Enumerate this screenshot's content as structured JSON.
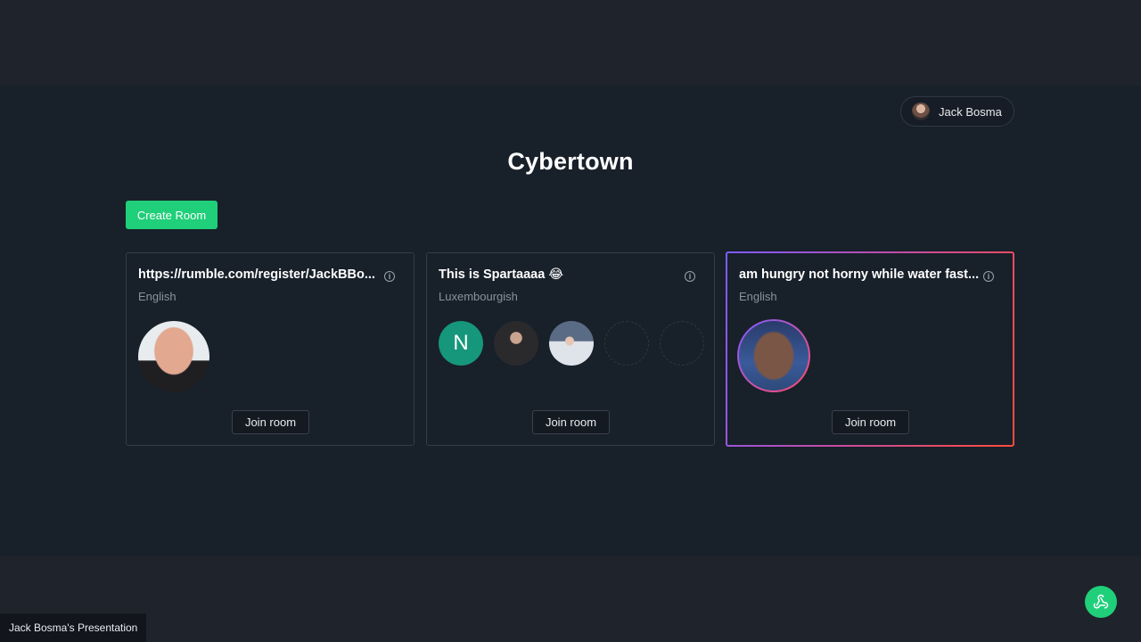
{
  "header": {
    "user_name": "Jack Bosma",
    "app_title": "Cybertown"
  },
  "actions": {
    "create_room_label": "Create Room"
  },
  "rooms": [
    {
      "title": "https://rumble.com/register/JackBBo...",
      "language": "English",
      "join_label": "Join room"
    },
    {
      "title": "This is Spartaaaa 😂",
      "language": "Luxembourgish",
      "join_label": "Join room",
      "participant_initial": "N"
    },
    {
      "title": "am hungry not horny while water fast...",
      "language": "English",
      "join_label": "Join room"
    }
  ],
  "footer": {
    "presenter_label": "Jack Bosma's Presentation"
  },
  "colors": {
    "accent": "#1fcf79",
    "background": "#18202a"
  }
}
